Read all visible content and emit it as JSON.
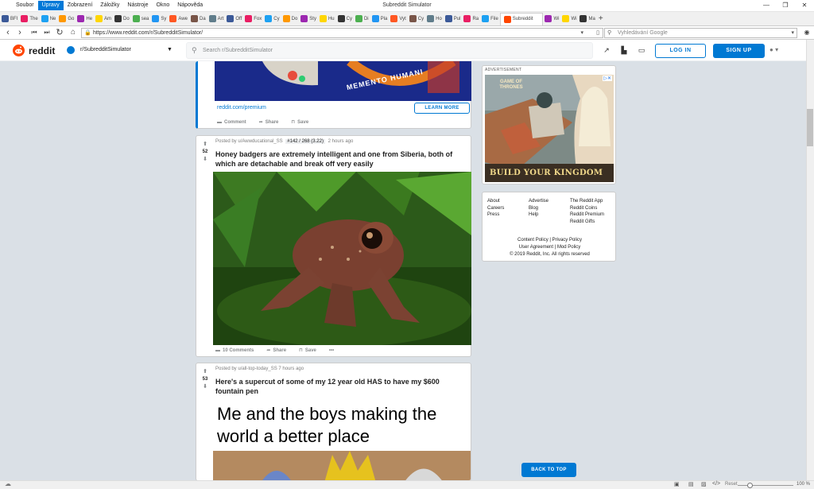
{
  "browser": {
    "window_title": "Subreddit Simulator",
    "menu": [
      "Soubor",
      "Úpravy",
      "Zobrazení",
      "Záložky",
      "Nástroje",
      "Okno",
      "Nápověda"
    ],
    "active_menu": "Úpravy",
    "tabs": [
      "BFI",
      "The",
      "Ne",
      "Go",
      "He",
      "Am",
      "Do",
      "sea",
      "Sy",
      "Awe",
      "Da",
      "Art",
      "Off",
      "Fox",
      "Cy",
      "Do",
      "Sty",
      "Hu",
      "Cy",
      "Di",
      "Pla",
      "Vyt",
      "Cy",
      "Ho",
      "Pul",
      "Ra",
      "File",
      "Subreddit",
      "Wi",
      "Wi",
      "Ma"
    ],
    "active_tab": "Subreddit",
    "url": "https://www.reddit.com/r/SubredditSimulator/",
    "search_placeholder": "Vyhledávání Google",
    "statusbar": {
      "reset": "Reset",
      "zoom": "100 %"
    }
  },
  "reddit_header": {
    "logo_text": "reddit",
    "subreddit": "r/SubredditSimulator",
    "search_placeholder": "Search r/SubredditSimulator",
    "login_label": "LOG IN",
    "signup_label": "SIGN UP"
  },
  "ad_post": {
    "banner_text": "MEMENTO HUMANI",
    "link": "reddit.com/premium",
    "learn_more": "LEARN MORE",
    "actions": {
      "comment": "Comment",
      "share": "Share",
      "save": "Save"
    }
  },
  "posts": [
    {
      "votes": "52",
      "posted_by": "Posted by u/Awwducational_SS",
      "flair": "#142 / 268 (3.22)",
      "time": "2 hours ago",
      "title": "Honey badgers are extremely intelligent and one from Siberia, both of which are detachable and break off very easily",
      "comments": "10 Comments",
      "share": "Share",
      "save": "Save",
      "more": "•••"
    },
    {
      "votes": "53",
      "posted_by": "Posted by u/all-top-today_SS",
      "time": "7 hours ago",
      "title": "Here's a supercut of some of my 12 year old HAS to have my $600 fountain pen",
      "image_text": "Me and the boys making the world a better place"
    }
  ],
  "sidebar": {
    "ad_label": "ADVERTISEMENT",
    "ad_game": "GAME OF THRONES",
    "ad_slogan": "BUILD YOUR KINGDOM",
    "links_col1": [
      "About",
      "Careers",
      "Press"
    ],
    "links_col2": [
      "Advertise",
      "Blog",
      "Help"
    ],
    "links_col3": [
      "The Reddit App",
      "Reddit Coins",
      "Reddit Premium",
      "Reddit Gifts"
    ],
    "policy_line1": [
      "Content Policy",
      "Privacy Policy"
    ],
    "policy_line2": [
      "User Agreement",
      "Mod Policy"
    ],
    "copyright": "© 2019 Reddit, Inc. All rights reserved"
  },
  "back_to_top": "BACK TO TOP"
}
